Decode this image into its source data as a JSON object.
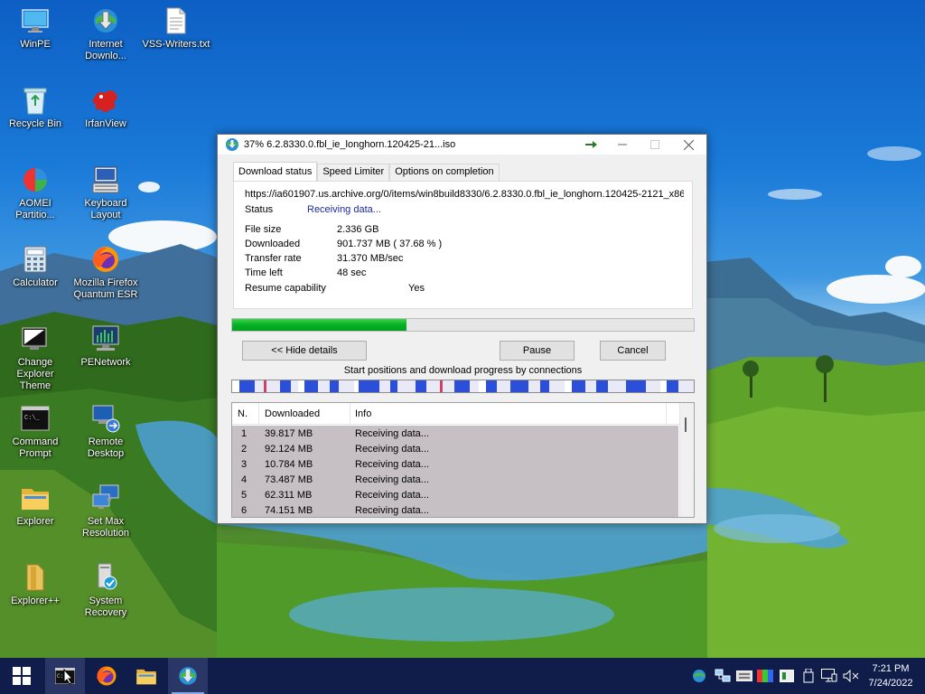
{
  "desktop": {
    "icons": [
      {
        "label": "WinPE",
        "icon": "monitor-icon"
      },
      {
        "label": "Internet Downlo...",
        "icon": "idm-icon"
      },
      {
        "label": "VSS-Writers.txt",
        "icon": "text-file-icon"
      },
      {
        "label": "Recycle Bin",
        "icon": "recycle-bin-icon"
      },
      {
        "label": "IrfanView",
        "icon": "irfanview-icon"
      },
      {
        "label": "AOMEI Partitio...",
        "icon": "aomei-icon"
      },
      {
        "label": "Keyboard Layout",
        "icon": "keyboard-icon"
      },
      {
        "label": "Calculator",
        "icon": "calculator-icon"
      },
      {
        "label": "Mozilla Firefox Quantum ESR",
        "icon": "firefox-icon"
      },
      {
        "label": "Change Explorer Theme",
        "icon": "theme-icon"
      },
      {
        "label": "PENetwork",
        "icon": "network-icon"
      },
      {
        "label": "Command Prompt",
        "icon": "cmd-icon"
      },
      {
        "label": "Remote Desktop",
        "icon": "remote-desktop-icon"
      },
      {
        "label": "Explorer",
        "icon": "folder-icon"
      },
      {
        "label": "Set Max Resolution",
        "icon": "resolution-icon"
      },
      {
        "label": "Explorer++",
        "icon": "explorerpp-icon"
      },
      {
        "label": "System Recovery",
        "icon": "recovery-icon"
      }
    ]
  },
  "window": {
    "title": "37% 6.2.8330.0.fbl_ie_longhorn.120425-21...iso",
    "tabs": [
      "Download status",
      "Speed Limiter",
      "Options on completion"
    ],
    "url": "https://ia601907.us.archive.org/0/items/win8build8330/6.2.8330.0.fbl_ie_longhorn.120425-2121_x86",
    "status_label": "Status",
    "status_value": "Receiving data...",
    "file_size_label": "File size",
    "file_size_value": "2.336  GB",
    "downloaded_label": "Downloaded",
    "downloaded_value": "901.737  MB  ( 37.68 % )",
    "transfer_rate_label": "Transfer rate",
    "transfer_rate_value": "31.370  MB/sec",
    "time_left_label": "Time left",
    "time_left_value": "48 sec",
    "resume_label": "Resume capability",
    "resume_value": "Yes",
    "progress_fraction": 0.3768,
    "hide_details_label": "<< Hide details",
    "pause_label": "Pause",
    "cancel_label": "Cancel",
    "connections_caption": "Start positions and download progress by connections",
    "columns": [
      "N.",
      "Downloaded",
      "Info"
    ],
    "connections": [
      {
        "n": "1",
        "downloaded": "39.817  MB",
        "info": "Receiving data..."
      },
      {
        "n": "2",
        "downloaded": "92.124  MB",
        "info": "Receiving data..."
      },
      {
        "n": "3",
        "downloaded": "10.784  MB",
        "info": "Receiving data..."
      },
      {
        "n": "4",
        "downloaded": "73.487  MB",
        "info": "Receiving data..."
      },
      {
        "n": "5",
        "downloaded": "62.311  MB",
        "info": "Receiving data..."
      },
      {
        "n": "6",
        "downloaded": "74.151  MB",
        "info": "Receiving data..."
      }
    ]
  },
  "taskbar": {
    "buttons": [
      "start-icon",
      "cmd-icon",
      "firefox-icon",
      "explorer-icon",
      "idm-icon"
    ],
    "tray_icons": [
      "idm-tray-icon",
      "network-tray-icon",
      "keyboard-tray-icon",
      "color-tray-icon",
      "display-tray-icon",
      "usb-tray-icon",
      "monitor-tray-icon",
      "volume-muted-icon"
    ],
    "time": "7:21 PM",
    "date": "7/24/2022"
  },
  "colors": {
    "progress_green": "#06b025",
    "taskbar": "#101c4a",
    "connection_blue": "#2b4fd8"
  }
}
